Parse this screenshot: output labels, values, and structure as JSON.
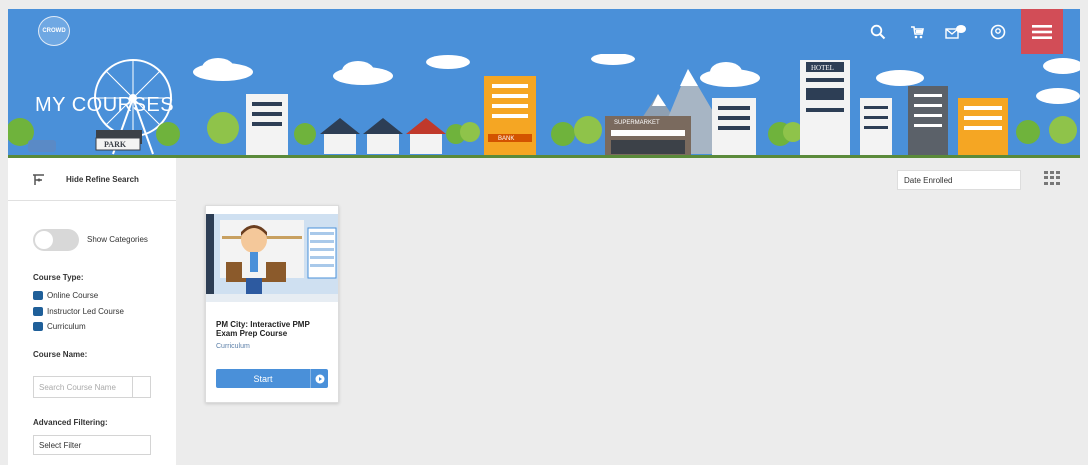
{
  "header": {
    "logo_text": "CROWD",
    "icons": [
      "search-icon",
      "cart-icon",
      "messages-icon",
      "account-icon",
      "menu-icon"
    ]
  },
  "banner": {
    "title": "MY COURSES",
    "sign_park": "PARK",
    "sign_hotel": "HOTEL",
    "sign_bank": "BANK",
    "sign_supermarket": "SUPERMARKET"
  },
  "sidebar": {
    "refine_label": "Hide Refine Search",
    "show_categories": "Show Categories",
    "course_type_heading": "Course Type:",
    "course_types": [
      "Online Course",
      "Instructor Led Course",
      "Curriculum"
    ],
    "course_name_heading": "Course Name:",
    "course_name_placeholder": "Search Course Name",
    "advanced_heading": "Advanced Filtering:",
    "advanced_value": "Select Filter"
  },
  "main": {
    "sort_value": "Date Enrolled"
  },
  "course": {
    "title": "PM City: Interactive PMP Exam Prep Course",
    "type": "Curriculum",
    "start_label": "Start"
  },
  "colors": {
    "primary": "#4a90d9",
    "menu": "#d24d57",
    "checkbox": "#1f5f99"
  }
}
